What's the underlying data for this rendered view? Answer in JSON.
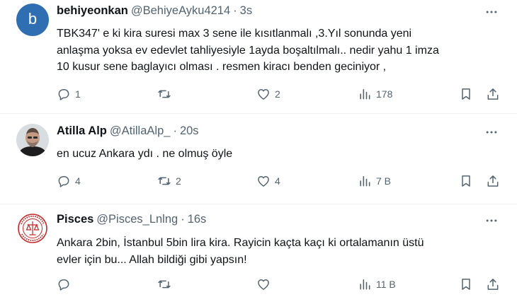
{
  "tweets": [
    {
      "avatar_letter": "b",
      "name": "behiyeonkan",
      "handle": "@BehiyeAyku4214",
      "separator": "·",
      "time": "3s",
      "lines": [
        "TBK347' e ki  kira suresi max  3 sene ile kısıtlanmalı ,3.Yıl sonunda yeni",
        "anlaşma yoksa ev edevlet tahliyesiyle 1ayda boşaltılmalı.. nedir yahu 1 imza",
        "10 kusur sene baglayıcı olması . resmen kiracı benden geciniyor ,"
      ],
      "replies": "1",
      "retweets": "",
      "likes": "2",
      "views": "178"
    },
    {
      "name": "Atilla Alp",
      "handle": "@AtillaAlp_",
      "separator": "·",
      "time": "20s",
      "lines": [
        "en ucuz Ankara ydı . ne olmuş öyle"
      ],
      "replies": "4",
      "retweets": "2",
      "likes": "4",
      "views": "7 B"
    },
    {
      "name": "Pisces",
      "handle": "@Pisces_Lnlng",
      "separator": "·",
      "time": "16s",
      "lines": [
        "Ankara 2bin, İstanbul 5bin lira kira. Rayicin kaçta kaçı ki ortalamanın üstü",
        "evler için bu... Allah bildiği gibi yapsın!"
      ],
      "replies": "",
      "retweets": "",
      "likes": "",
      "views": "11 B"
    }
  ],
  "icons": {
    "reply": "reply-icon",
    "retweet": "retweet-icon",
    "like": "like-icon",
    "views": "views-icon",
    "bookmark": "bookmark-icon",
    "share": "share-icon",
    "more": "more-icon"
  },
  "colors": {
    "text": "#0f1419",
    "secondary": "#536471",
    "divider": "#eff3f4",
    "avatar_b": "#2f6fb1"
  }
}
